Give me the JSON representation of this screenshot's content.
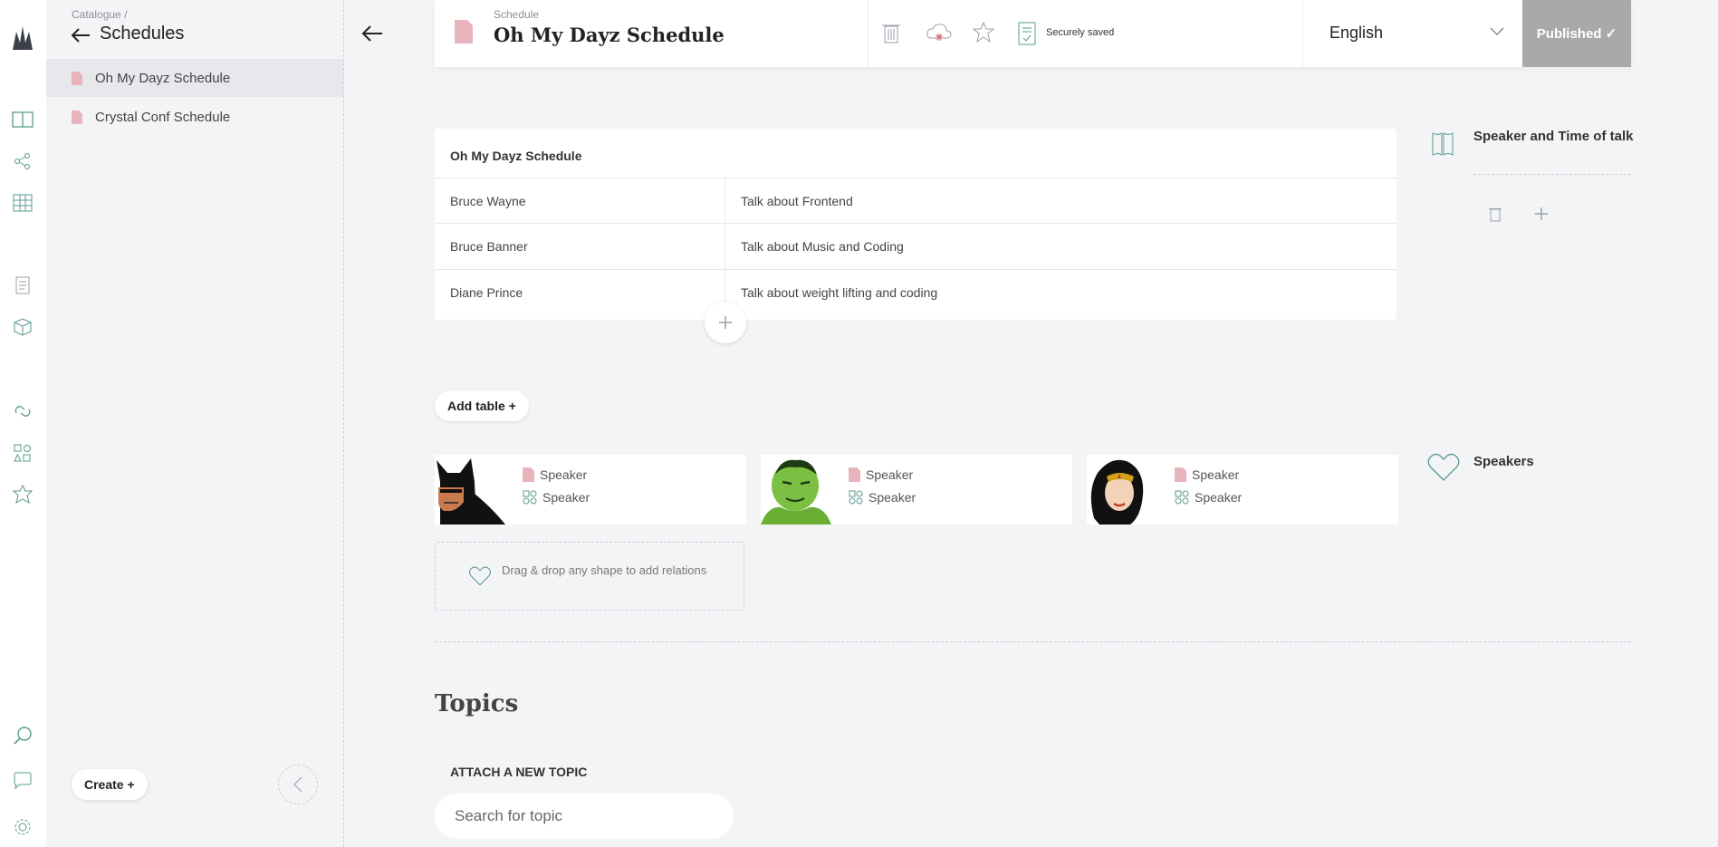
{
  "sidebar": {
    "breadcrumb": "Catalogue",
    "breadcrumb_sep": "/",
    "title": "Schedules",
    "items": [
      {
        "label": "Oh My Dayz Schedule",
        "active": true
      },
      {
        "label": "Crystal Conf Schedule",
        "active": false
      }
    ],
    "create_label": "Create +"
  },
  "rail_icons": [
    "logo-icon",
    "book-icon",
    "share-icon",
    "grid-icon",
    "document-icon",
    "cube-icon",
    "link-icon",
    "shapes-icon",
    "settings-star-icon",
    "search-icon",
    "chat-icon",
    "gear-icon"
  ],
  "topbar": {
    "type_label": "Schedule",
    "title": "Oh My Dayz Schedule",
    "saved_text": "Securely saved",
    "language": "English",
    "publish_label": "Published ✓"
  },
  "table": {
    "title": "Oh My Dayz Schedule",
    "rows": [
      [
        "Bruce Wayne",
        "Talk about Frontend"
      ],
      [
        "Bruce Banner",
        "Talk about Music and Coding"
      ],
      [
        "Diane Prince",
        "Talk about weight lifting and coding"
      ]
    ],
    "side_label": "Speaker and Time of talk"
  },
  "add_table_label": "Add table +",
  "speakers": {
    "label": "Speakers",
    "cards": [
      {
        "name": "batman",
        "line1": "Speaker",
        "line2": "Speaker"
      },
      {
        "name": "hulk",
        "line1": "Speaker",
        "line2": "Speaker"
      },
      {
        "name": "wonder-woman",
        "line1": "Speaker",
        "line2": "Speaker"
      }
    ],
    "drop_text": "Drag & drop any shape to add relations"
  },
  "topics": {
    "title": "Topics",
    "attach_label": "ATTACH A NEW TOPIC",
    "search_placeholder": "Search for topic"
  },
  "colors": {
    "accent_pink": "#e8b4bc",
    "accent_teal": "#5a9a8f",
    "publish_bg": "#a9a9a9"
  }
}
